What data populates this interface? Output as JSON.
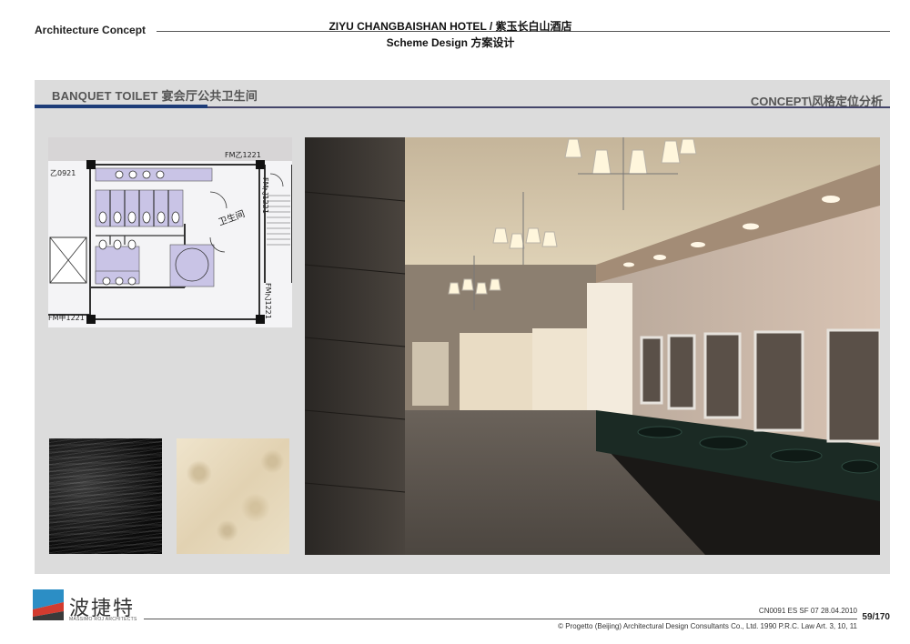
{
  "header": {
    "left_label": "Architecture Concept",
    "project_title": "ZIYU CHANGBAISHAN HOTEL / 紫玉长白山酒店",
    "subtitle": "Scheme Design 方案设计"
  },
  "section": {
    "title": "BANQUET TOILET 宴会厅公共卫生间",
    "right_label": "CONCEPT\\风格定位分析"
  },
  "floorplan": {
    "labels": {
      "door_top_right": "FM乙1221",
      "door_left": "乙0921",
      "door_right_vertical": "FM乙1221",
      "door_lower_right": "FM乙1221",
      "door_bottom_left": "FM甲1221",
      "room_name": "卫生间"
    }
  },
  "materials": [
    {
      "name": "black-marble-swatch"
    },
    {
      "name": "beige-marble-swatch"
    }
  ],
  "footer": {
    "logo_cn": "波捷特",
    "logo_en": "MASSIMO ROJ ARCHITECTS",
    "doc_code": "CN0091 ES SF 07  28.04.2010",
    "page": "59/170",
    "copyright": "© Progetto (Beijing) Architectural Design Consultants Co., Ltd. 1990 P.R.C. Law  Art. 3, 10, 11"
  },
  "colors": {
    "accent_blue": "#1d3c78",
    "panel_gray": "#dcdcdc",
    "rule_dark": "#44456a"
  }
}
